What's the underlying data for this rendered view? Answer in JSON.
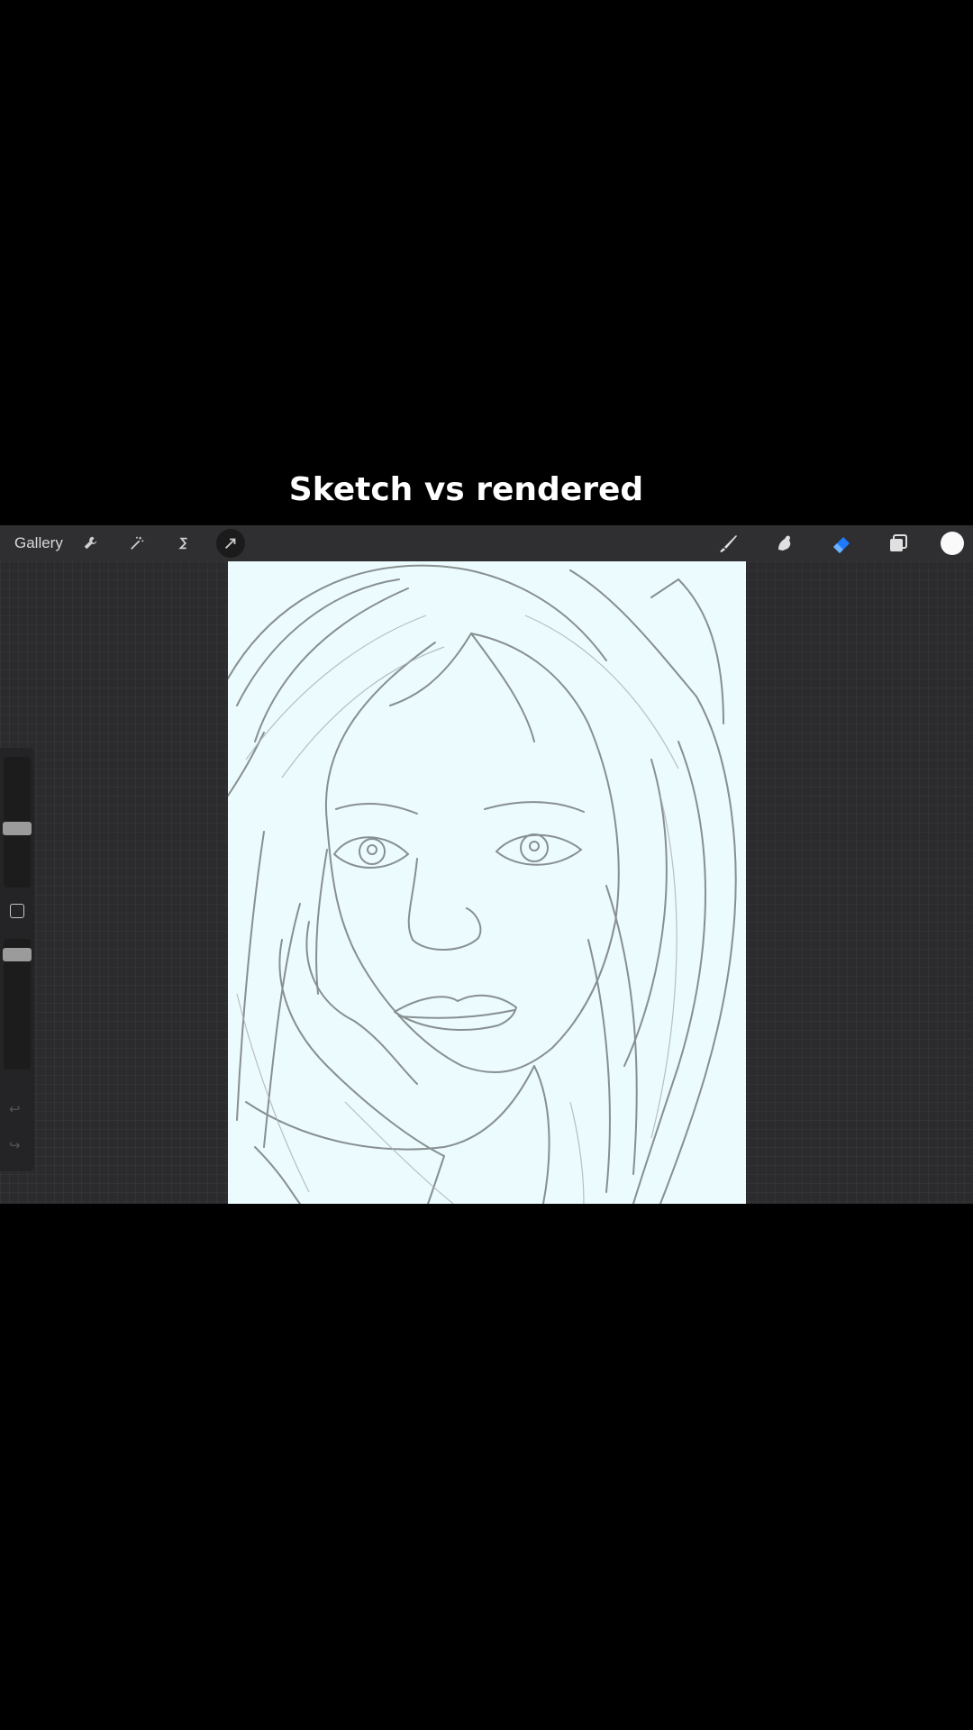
{
  "caption": "Sketch vs rendered",
  "toolbar": {
    "gallery_label": "Gallery",
    "left_tools": [
      "wrench-icon",
      "magic-wand-icon",
      "selection-s-icon",
      "transform-arrow-icon"
    ],
    "right_tools": [
      "brush-icon",
      "smudge-icon",
      "eraser-icon",
      "layers-icon"
    ],
    "active_tool": "eraser",
    "active_color": "#fafafa",
    "accent": "#1e7bff"
  },
  "sidebar": {
    "brush_size": 0.5,
    "opacity": 0.9
  }
}
